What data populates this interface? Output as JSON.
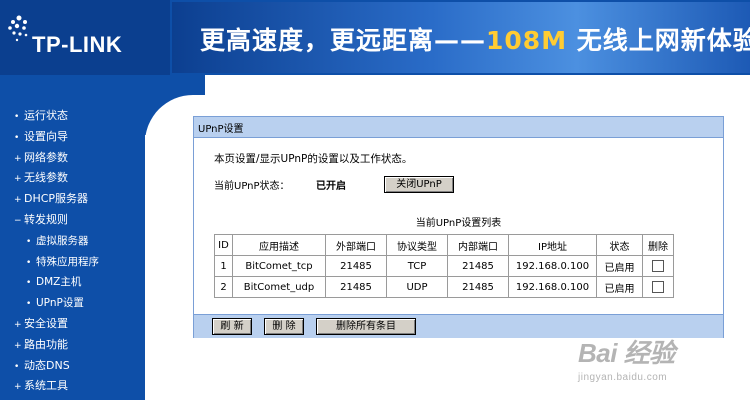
{
  "header": {
    "logo_text": "TP-LINK",
    "banner_prefix": "更高速度，更远距离——",
    "banner_highlight": "108M",
    "banner_suffix": " 无线上网新体验"
  },
  "nav": {
    "items": [
      {
        "label": "运行状态",
        "bullet": "•"
      },
      {
        "label": "设置向导",
        "bullet": "•"
      },
      {
        "label": "网络参数",
        "bullet": "+"
      },
      {
        "label": "无线参数",
        "bullet": "+"
      },
      {
        "label": "DHCP服务器",
        "bullet": "+"
      },
      {
        "label": "转发规则",
        "bullet": "−"
      },
      {
        "label": "虚拟服务器",
        "bullet": "•"
      },
      {
        "label": "特殊应用程序",
        "bullet": "•"
      },
      {
        "label": "DMZ主机",
        "bullet": "•"
      },
      {
        "label": "UPnP设置",
        "bullet": "•"
      },
      {
        "label": "安全设置",
        "bullet": "+"
      },
      {
        "label": "路由功能",
        "bullet": "+"
      },
      {
        "label": "动态DNS",
        "bullet": "•"
      },
      {
        "label": "系统工具",
        "bullet": "+"
      }
    ]
  },
  "panel": {
    "title": "UPnP设置",
    "description": "本页设置/显示UPnP的设置以及工作状态。",
    "status_label": "当前UPnP状态：",
    "status_value": "已开启",
    "toggle_button": "关闭UPnP",
    "table_caption": "当前UPnP设置列表",
    "table_headers": [
      "ID",
      "应用描述",
      "外部端口",
      "协议类型",
      "内部端口",
      "IP地址",
      "状态",
      "删除"
    ],
    "rows": [
      {
        "id": "1",
        "app": "BitComet_tcp",
        "ext_port": "21485",
        "protocol": "TCP",
        "int_port": "21485",
        "ip": "192.168.0.100",
        "status": "已启用"
      },
      {
        "id": "2",
        "app": "BitComet_udp",
        "ext_port": "21485",
        "protocol": "UDP",
        "int_port": "21485",
        "ip": "192.168.0.100",
        "status": "已启用"
      }
    ],
    "buttons": {
      "refresh": "刷 新",
      "delete": "删 除",
      "delete_all": "删除所有条目"
    }
  },
  "watermark": {
    "main": "Bai 经验",
    "sub": "jingyan.baidu.com"
  },
  "colors": {
    "nav_blue": "#0e4fa8",
    "panel_header": "#b9d0ef",
    "panel_border": "#7a9fd6"
  }
}
